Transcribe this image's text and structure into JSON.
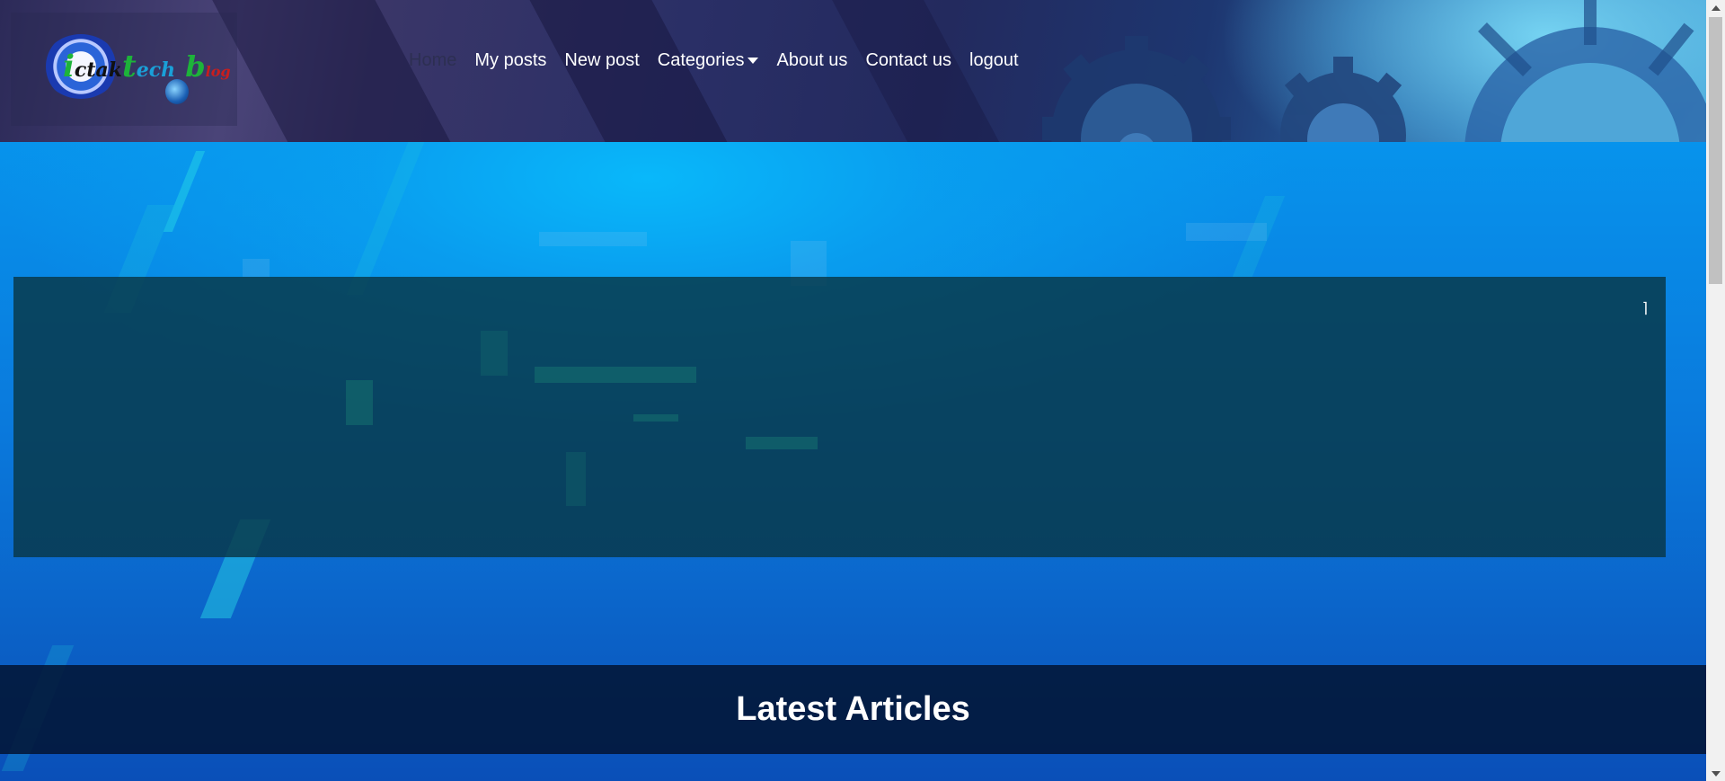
{
  "logo": {
    "text_parts": [
      "i",
      "ctak",
      "t",
      "ech",
      " b",
      "log"
    ],
    "alt": "ictaktech blog"
  },
  "nav": {
    "items": [
      {
        "label": "Home",
        "active": true
      },
      {
        "label": "My posts",
        "active": false
      },
      {
        "label": "New post",
        "active": false
      },
      {
        "label": "Categories",
        "active": false,
        "dropdown": true
      },
      {
        "label": "About us",
        "active": false
      },
      {
        "label": "Contact us",
        "active": false
      },
      {
        "label": "logout",
        "active": false
      }
    ]
  },
  "banner": {
    "corner_glyph": "⌉"
  },
  "section": {
    "title": "Latest Articles"
  },
  "icons": {
    "dropdown": "caret-down-icon",
    "scroll_up": "scroll-up-arrow-icon",
    "scroll_down": "scroll-down-arrow-icon"
  },
  "colors": {
    "nav_text": "#ffffff",
    "nav_active": "#2d2f52",
    "hero_blue": "#0793ec",
    "panel": "#08374a",
    "latest_bar": "#02142f"
  }
}
